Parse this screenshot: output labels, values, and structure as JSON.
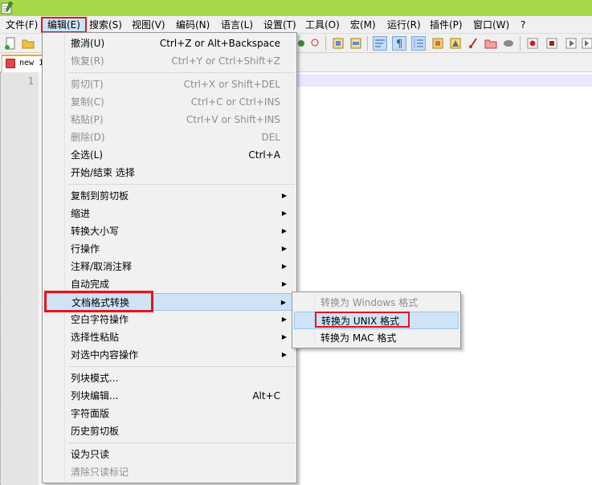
{
  "menubar": {
    "items": [
      {
        "label": "文件(F)"
      },
      {
        "label": "编辑(E)"
      },
      {
        "label": "搜索(S)"
      },
      {
        "label": "视图(V)"
      },
      {
        "label": "编码(N)"
      },
      {
        "label": "语言(L)"
      },
      {
        "label": "设置(T)"
      },
      {
        "label": "工具(O)"
      },
      {
        "label": "宏(M)"
      },
      {
        "label": "运行(R)"
      },
      {
        "label": "插件(P)"
      },
      {
        "label": "窗口(W)"
      },
      {
        "label": "?"
      }
    ]
  },
  "tab": {
    "label": "new 1"
  },
  "editor": {
    "line_number": "1"
  },
  "edit_menu": {
    "items": [
      {
        "label": "撤消(U)",
        "shortcut": "Ctrl+Z or Alt+Backspace",
        "disabled": false
      },
      {
        "label": "恢复(R)",
        "shortcut": "Ctrl+Y or Ctrl+Shift+Z",
        "disabled": true
      },
      {
        "label": "剪切(T)",
        "shortcut": "Ctrl+X or Shift+DEL",
        "disabled": true
      },
      {
        "label": "复制(C)",
        "shortcut": "Ctrl+C or Ctrl+INS",
        "disabled": true
      },
      {
        "label": "粘贴(P)",
        "shortcut": "Ctrl+V or Shift+INS",
        "disabled": true
      },
      {
        "label": "删除(D)",
        "shortcut": "DEL",
        "disabled": true
      },
      {
        "label": "全选(L)",
        "shortcut": "Ctrl+A",
        "disabled": false
      },
      {
        "label": "开始/结束 选择",
        "shortcut": "",
        "disabled": false
      },
      {
        "label": "复制到剪切板",
        "submenu": true
      },
      {
        "label": "缩进",
        "submenu": true
      },
      {
        "label": "转换大小写",
        "submenu": true
      },
      {
        "label": "行操作",
        "submenu": true
      },
      {
        "label": "注释/取消注释",
        "submenu": true
      },
      {
        "label": "自动完成",
        "submenu": true
      },
      {
        "label": "文档格式转换",
        "submenu": true
      },
      {
        "label": "空白字符操作",
        "submenu": true
      },
      {
        "label": "选择性粘贴",
        "submenu": true
      },
      {
        "label": "对选中内容操作",
        "submenu": true
      },
      {
        "label": "列块模式...",
        "shortcut": ""
      },
      {
        "label": "列块编辑...",
        "shortcut": "Alt+C"
      },
      {
        "label": "字符面版",
        "shortcut": ""
      },
      {
        "label": "历史剪切板",
        "shortcut": ""
      },
      {
        "label": "设为只读",
        "shortcut": ""
      },
      {
        "label": "清除只读标记",
        "shortcut": "",
        "disabled": true
      }
    ]
  },
  "submenu_arrow": "▶",
  "convert_submenu": {
    "items": [
      {
        "label": "转换为 Windows 格式",
        "disabled": true
      },
      {
        "label": "转换为 UNIX 格式",
        "disabled": false
      },
      {
        "label": "转换为 MAC 格式",
        "disabled": false
      }
    ]
  },
  "colors": {
    "title_strip": "#a7d84c",
    "highlight_box": "#e8141b",
    "menu_hover": "#cfe3f7",
    "current_line": "#e8e8ff"
  }
}
